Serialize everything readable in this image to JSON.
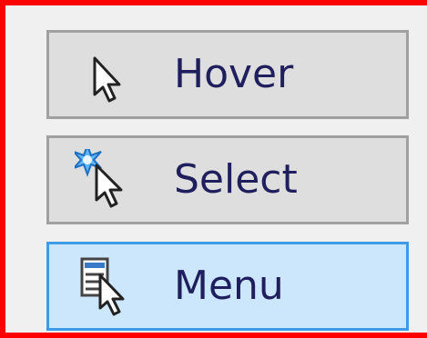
{
  "options": [
    {
      "label": "Hover",
      "icon": "hover-cursor-icon",
      "selected": false
    },
    {
      "label": "Select",
      "icon": "select-cursor-icon",
      "selected": false
    },
    {
      "label": "Menu",
      "icon": "menu-cursor-icon",
      "selected": true
    }
  ],
  "colors": {
    "frame_border": "#ff0000",
    "button_bg": "#dedede",
    "button_border": "#a0a0a0",
    "selected_bg": "#cce6fc",
    "selected_border": "#3f9ae8",
    "label_text": "#1f1f5e"
  }
}
